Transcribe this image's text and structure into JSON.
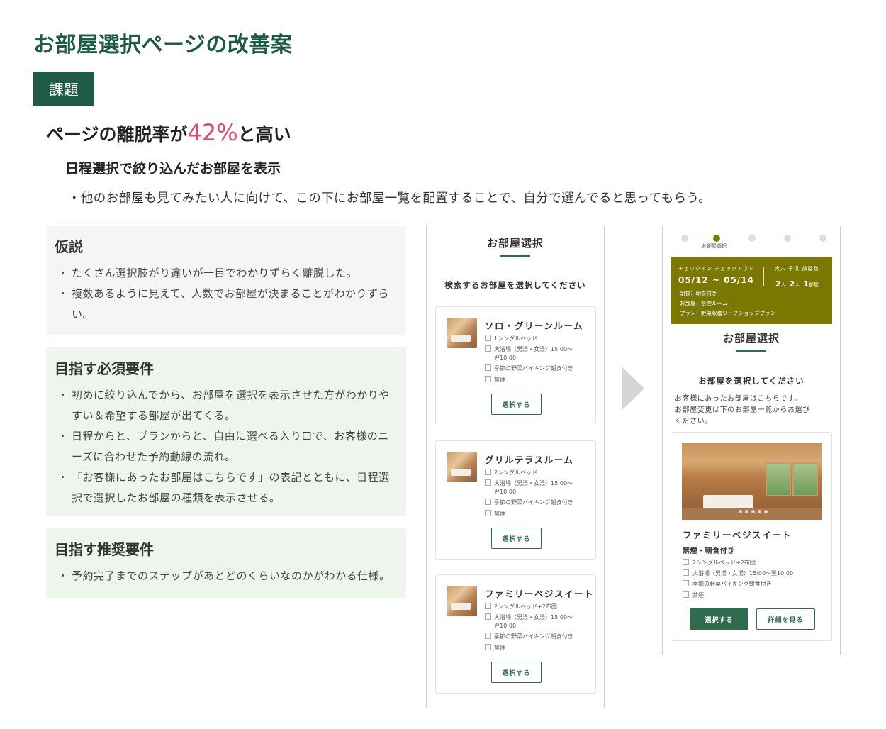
{
  "title": "お部屋選択ページの改善案",
  "issue_badge": "課題",
  "headline": {
    "prefix": "ページの離脱率が",
    "percent": "42%",
    "suffix": "と高い"
  },
  "subhead": "日程選択で絞り込んだお部屋を表示",
  "bullet": "・他のお部屋も見てみたい人に向けて、この下にお部屋一覧を配置することで、自分で選んでると思ってもらう。",
  "hypothesis": {
    "title": "仮説",
    "items": [
      "たくさん選択肢がり違いが一目でわかりずらく離脱した。",
      "複数あるように見えて、人数でお部屋が決まることがわかりずらい。"
    ]
  },
  "required": {
    "title": "目指す必須要件",
    "items": [
      "初めに絞り込んでから、お部屋を選択を表示させた方がわかりやすい＆希望する部屋が出てくる。",
      "日程からと、プランからと、自由に選べる入り口で、お客様のニーズに合わせた予約動線の流れ。",
      "「お客様にあったお部屋はこちらです」の表記とともに、日程選択で選択したお部屋の種類を表示させる。"
    ]
  },
  "recommended": {
    "title": "目指す推奨要件",
    "items": [
      "予約完了までのステップがあとどのくらいなのかがわかる仕様。"
    ]
  },
  "before": {
    "title": "お部屋選択",
    "subtitle": "検索するお部屋を選択してください",
    "button_label": "選択する",
    "rooms": [
      {
        "name": "ソロ・グリーンルーム",
        "bed": "1シングルベッド",
        "bath1": "大浴場（男湯・女湯）15:00〜",
        "bath2": "翌10:00",
        "meal": "季節の野菜バイキング朝食付き",
        "smoke": "禁煙"
      },
      {
        "name": "グリルテラスルーム",
        "bed": "2シングルベッド",
        "bath1": "大浴場（男湯・女湯）15:00〜",
        "bath2": "翌10:00",
        "meal": "季節の野菜バイキング朝食付き",
        "smoke": "禁煙"
      },
      {
        "name": "ファミリーベジスイート",
        "bed": "2シングルベッド+2布団",
        "bath1": "大浴場（男湯・女湯）15:00〜",
        "bath2": "翌10:00",
        "meal": "季節の野菜バイキング朝食付き",
        "smoke": "禁煙"
      }
    ]
  },
  "after": {
    "step_label": "お部屋選択",
    "summary": {
      "checkin_label": "チェックイン チェックアウト",
      "dates": "05/12 ~ 05/14",
      "guests_label": "大人 子供 部屋数",
      "adults": "2",
      "children": "2",
      "rooms": "1",
      "unit_person": "人",
      "unit_room": "部屋",
      "meal_link": "朝食：朝食付き",
      "room_link": "お部屋：禁煙ルーム",
      "plan_link": "プラン：野菜収穫ワークショッププラン"
    },
    "title": "お部屋選択",
    "subtitle": "お部屋を選択してください",
    "description_line1": "お客様にあったお部屋はこちらです。",
    "description_line2": "お部屋変更は下のお部屋一覧からお選び",
    "description_line3": "ください。",
    "room": {
      "name": "ファミリーベジスイート",
      "tag": "禁煙・朝食付き",
      "bed": "2シングルベッド+2布団",
      "bath": "大浴場（男湯・女湯）15:00〜翌10:00",
      "meal": "季節の野菜バイキング朝食付き",
      "smoke": "禁煙"
    },
    "select_label": "選択する",
    "detail_label": "詳細を見る"
  }
}
